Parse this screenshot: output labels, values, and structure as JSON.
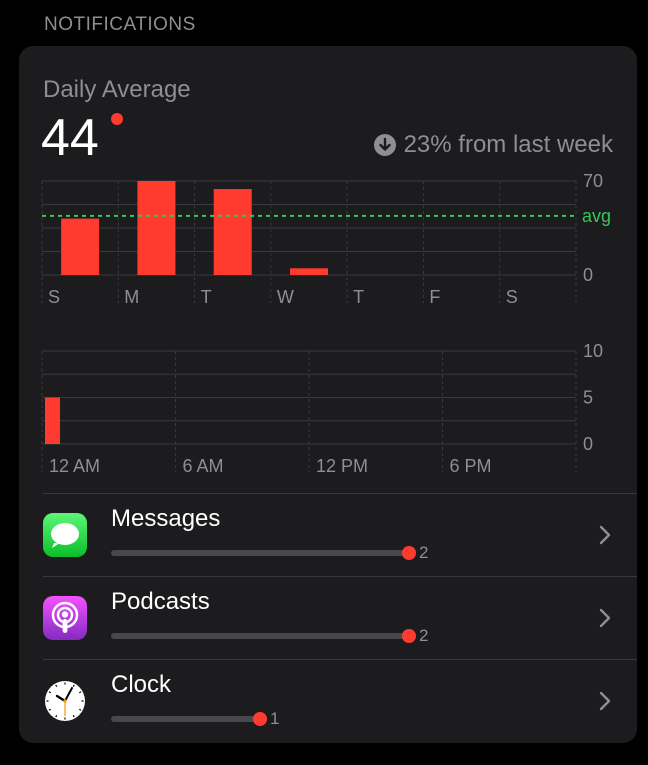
{
  "section_label": "NOTIFICATIONS",
  "daily_average": {
    "label": "Daily Average",
    "value": "44",
    "trend_text": "23% from last week",
    "trend_direction": "down"
  },
  "colors": {
    "background": "#000000",
    "card": "#1c1c1e",
    "bar": "#ff3b30",
    "avg_line": "#34c759",
    "secondary_text": "#8e8e93",
    "track": "#48484a"
  },
  "chart_data": [
    {
      "type": "bar",
      "categories": [
        "S",
        "M",
        "T",
        "W",
        "T",
        "F",
        "S"
      ],
      "values": [
        42,
        70,
        64,
        5,
        0,
        0,
        0
      ],
      "ylim": [
        0,
        70
      ],
      "yticks": [
        "0",
        "70"
      ],
      "average": 44,
      "average_label": "avg",
      "grid": true
    },
    {
      "type": "bar",
      "categories": [
        "12 AM",
        "6 AM",
        "12 PM",
        "6 PM"
      ],
      "values": [
        5
      ],
      "hours": [
        0
      ],
      "ylim": [
        0,
        10
      ],
      "yticks": [
        "0",
        "5",
        "10"
      ],
      "grid": true
    }
  ],
  "apps": [
    {
      "name": "Messages",
      "count": "2",
      "fraction": 1.0,
      "icon": "messages-icon"
    },
    {
      "name": "Podcasts",
      "count": "2",
      "fraction": 1.0,
      "icon": "podcasts-icon"
    },
    {
      "name": "Clock",
      "count": "1",
      "fraction": 0.5,
      "icon": "clock-icon"
    }
  ]
}
